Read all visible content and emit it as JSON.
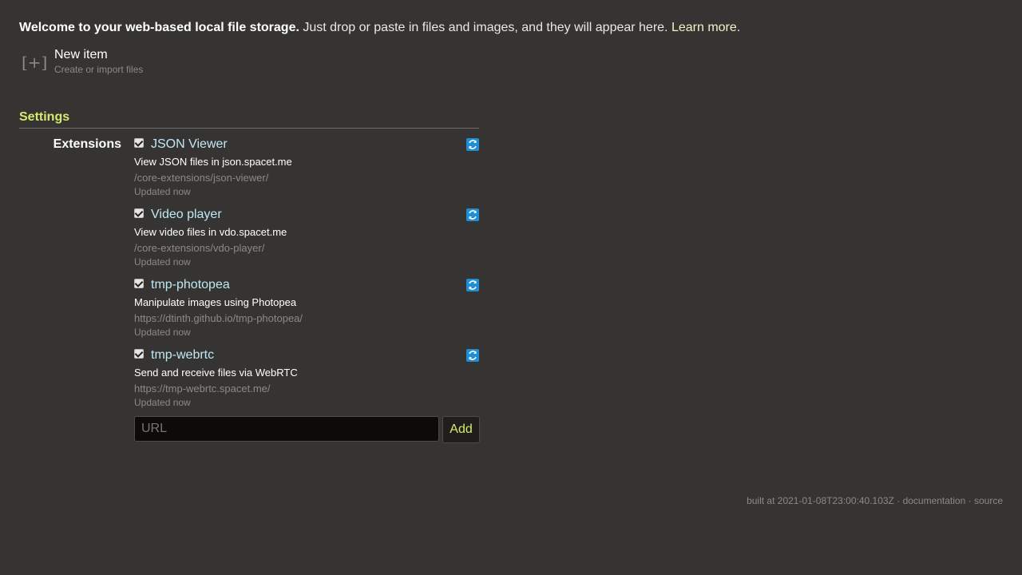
{
  "welcome": {
    "bold": "Welcome to your web-based local file storage.",
    "text": " Just drop or paste in files and images, and they will appear here. ",
    "link": "Learn more",
    "period": "."
  },
  "new_item": {
    "icon": "[+]",
    "title": "New item",
    "subtitle": "Create or import files"
  },
  "settings": {
    "heading": "Settings",
    "extensions_label": "Extensions",
    "extensions": [
      {
        "name": "JSON Viewer",
        "description": "View JSON files in json.spacet.me",
        "url": "/core-extensions/json-viewer/",
        "updated": "Updated now",
        "checked": true
      },
      {
        "name": "Video player",
        "description": "View video files in vdo.spacet.me",
        "url": "/core-extensions/vdo-player/",
        "updated": "Updated now",
        "checked": true
      },
      {
        "name": "tmp-photopea",
        "description": "Manipulate images using Photopea",
        "url": "https://dtinth.github.io/tmp-photopea/",
        "updated": "Updated now",
        "checked": true
      },
      {
        "name": "tmp-webrtc",
        "description": "Send and receive files via WebRTC",
        "url": "https://tmp-webrtc.spacet.me/",
        "updated": "Updated now",
        "checked": true
      }
    ],
    "url_input": {
      "value": "",
      "placeholder": "URL"
    },
    "add_label": "Add"
  },
  "footer": {
    "built": "built at 2021-01-08T23:00:40.103Z",
    "sep": " · ",
    "documentation": "documentation",
    "source": "source"
  },
  "colors": {
    "background": "#353432",
    "accent": "#d6ea6e",
    "link": "#bfe9f5",
    "refresh_icon": "#1f8ed6"
  }
}
